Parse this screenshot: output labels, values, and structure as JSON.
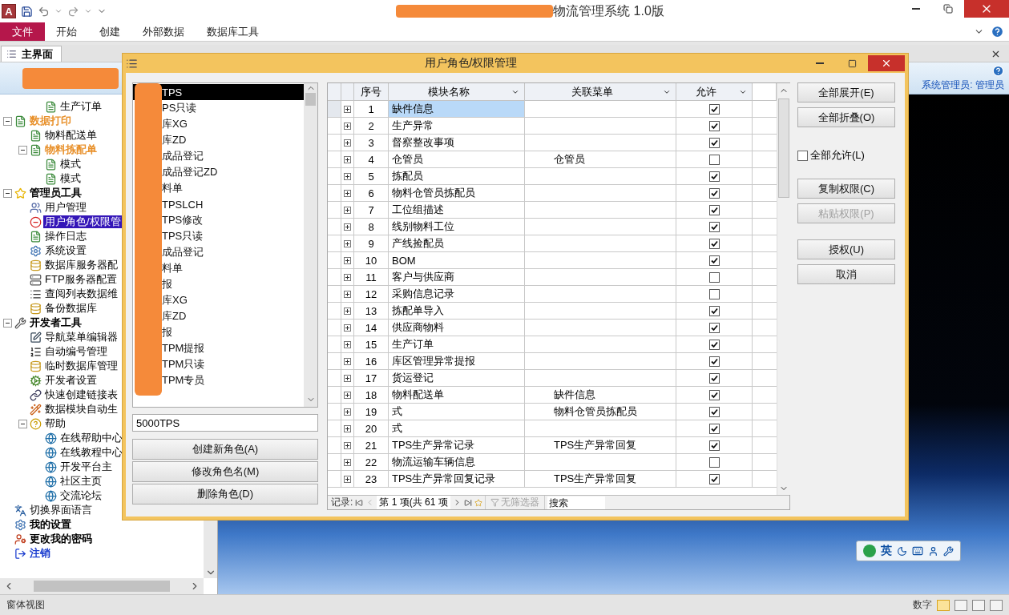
{
  "app": {
    "logo": "A",
    "title": "物流管理系统 1.0版"
  },
  "ribbon_tabs": [
    {
      "label": "文件",
      "selected": true
    },
    {
      "label": "开始",
      "selected": false
    },
    {
      "label": "创建",
      "selected": false
    },
    {
      "label": "外部数据",
      "selected": false
    },
    {
      "label": "数据库工具",
      "selected": false
    }
  ],
  "document_tab": {
    "label": "主界面"
  },
  "banner": {
    "user": "系统管理员: 管理员"
  },
  "nav_tree": [
    {
      "children": [
        {
          "children": [
            {
              "label": "生产订单",
              "kind": "page",
              "selected": false
            }
          ]
        }
      ]
    },
    {
      "label": "数据打印",
      "kind": "folder",
      "selected": false,
      "expanded": true,
      "children": [
        {
          "label": "物料配送单",
          "kind": "page",
          "selected": false
        },
        {
          "label": "物料拣配单",
          "kind": "folder",
          "selected": false,
          "expanded": true,
          "children": [
            {
              "label": "模式",
              "kind": "page",
              "selected": false
            },
            {
              "label": "模式",
              "kind": "page",
              "selected": false
            }
          ]
        }
      ]
    },
    {
      "label": "管理员工具",
      "kind": "category",
      "selected": false,
      "expanded": true,
      "children": [
        {
          "label": "用户管理",
          "kind": "page",
          "selected": false
        },
        {
          "label": "用户角色/权限管",
          "kind": "page",
          "selected": true
        },
        {
          "label": "操作日志",
          "kind": "page",
          "selected": false
        },
        {
          "label": "系统设置",
          "kind": "page",
          "selected": false
        },
        {
          "label": "数据库服务器配",
          "kind": "page",
          "selected": false
        },
        {
          "label": "FTP服务器配置",
          "kind": "page",
          "selected": false
        },
        {
          "label": "查阅列表数据维",
          "kind": "page",
          "selected": false
        },
        {
          "label": "备份数据库",
          "kind": "page",
          "selected": false
        }
      ]
    },
    {
      "label": "开发者工具",
      "kind": "category",
      "selected": false,
      "expanded": true,
      "children": [
        {
          "label": "导航菜单编辑器",
          "kind": "page",
          "selected": false
        },
        {
          "label": "自动编号管理",
          "kind": "page",
          "selected": false
        },
        {
          "label": "临时数据库管理",
          "kind": "page",
          "selected": false
        },
        {
          "label": "开发者设置",
          "kind": "page",
          "selected": false
        },
        {
          "label": "快速创建链接表",
          "kind": "page",
          "selected": false
        },
        {
          "label": "数据模块自动生",
          "kind": "page",
          "selected": false
        },
        {
          "label": "帮助",
          "kind": "page",
          "selected": false,
          "expanded": true,
          "children": [
            {
              "label": "在线帮助中心",
              "kind": "page",
              "selected": false
            },
            {
              "label": "在线教程中心",
              "kind": "page",
              "selected": false
            },
            {
              "label": "开发平台主",
              "kind": "page",
              "selected": false
            },
            {
              "label": "社区主页",
              "kind": "page",
              "selected": false
            },
            {
              "label": "交流论坛",
              "kind": "page",
              "selected": false
            }
          ]
        }
      ]
    },
    {
      "label": "切换界面语言",
      "kind": "page",
      "selected": false
    },
    {
      "label": "我的设置",
      "kind": "action",
      "selected": false
    },
    {
      "label": "更改我的密码",
      "kind": "action",
      "selected": false
    },
    {
      "label": "注销",
      "kind": "signout",
      "selected": false
    }
  ],
  "dialog": {
    "title": "用户角色/权限管理",
    "roles": [
      {
        "label": "TPS",
        "selected": true
      },
      {
        "label": "PS只读",
        "selected": false
      },
      {
        "label": "库XG",
        "selected": false
      },
      {
        "label": "库ZD",
        "selected": false
      },
      {
        "label": "成品登记",
        "selected": false
      },
      {
        "label": "成品登记ZD",
        "selected": false
      },
      {
        "label": "料单",
        "selected": false
      },
      {
        "label": "TPSLCH",
        "selected": false
      },
      {
        "label": "TPS修改",
        "selected": false
      },
      {
        "label": "TPS只读",
        "selected": false
      },
      {
        "label": "成品登记",
        "selected": false
      },
      {
        "label": "料单",
        "selected": false
      },
      {
        "label": "报",
        "selected": false
      },
      {
        "label": "库XG",
        "selected": false
      },
      {
        "label": "库ZD",
        "selected": false
      },
      {
        "label": "报",
        "selected": false
      },
      {
        "label": "TPM提报",
        "selected": false
      },
      {
        "label": "TPM只读",
        "selected": false
      },
      {
        "label": "TPM专员",
        "selected": false
      }
    ],
    "role_name": "5000TPS",
    "role_buttons": [
      "创建新角色(A)",
      "修改角色名(M)",
      "删除角色(D)"
    ],
    "table": {
      "columns": [
        "序号",
        "模块名称",
        "关联菜单",
        "允许"
      ],
      "rows": [
        {
          "seq": "1",
          "module": "缺件信息",
          "allowed": true,
          "selected": true
        },
        {
          "seq": "2",
          "module": "生产异常",
          "allowed": true,
          "selected": false
        },
        {
          "seq": "3",
          "module": "督察整改事项",
          "allowed": true,
          "selected": false
        },
        {
          "seq": "4",
          "module": "仓管员",
          "menu": "仓管员",
          "allowed": false,
          "selected": false
        },
        {
          "seq": "5",
          "module": "拣配员",
          "allowed": true,
          "selected": false
        },
        {
          "seq": "6",
          "module": "物料仓管员拣配员",
          "allowed": true,
          "selected": false
        },
        {
          "seq": "7",
          "module": "工位组描述",
          "allowed": true,
          "selected": false
        },
        {
          "seq": "8",
          "module": "线别物料工位",
          "allowed": true,
          "selected": false
        },
        {
          "seq": "9",
          "module": "产线捡配员",
          "allowed": true,
          "selected": false
        },
        {
          "seq": "10",
          "module": "BOM",
          "allowed": true,
          "selected": false
        },
        {
          "seq": "11",
          "module": "客户与供应商",
          "allowed": false,
          "selected": false
        },
        {
          "seq": "12",
          "module": "采购信息记录",
          "allowed": false,
          "selected": false
        },
        {
          "seq": "13",
          "module": "拣配单导入",
          "allowed": true,
          "selected": false
        },
        {
          "seq": "14",
          "module": "供应商物料",
          "allowed": true,
          "selected": false
        },
        {
          "seq": "15",
          "module": "生产订单",
          "allowed": true,
          "selected": false
        },
        {
          "seq": "16",
          "module": "库区管理异常提报",
          "allowed": true,
          "selected": false
        },
        {
          "seq": "17",
          "module": "货运登记",
          "allowed": true,
          "selected": false
        },
        {
          "seq": "18",
          "module": "物料配送单",
          "menu": "缺件信息",
          "allowed": true,
          "selected": false
        },
        {
          "seq": "19",
          "module": "式",
          "menu": "物料仓管员拣配员",
          "allowed": true,
          "selected": false
        },
        {
          "seq": "20",
          "module": "式",
          "allowed": true,
          "selected": false
        },
        {
          "seq": "21",
          "module": "TPS生产异常记录",
          "menu": "TPS生产异常回复",
          "allowed": true,
          "selected": false
        },
        {
          "seq": "22",
          "module": "物流运输车辆信息",
          "allowed": false,
          "selected": false
        },
        {
          "seq": "23",
          "module": "TPS生产异常回复记录",
          "menu": "TPS生产异常回复",
          "allowed": true,
          "selected": false
        }
      ]
    },
    "record_nav": {
      "label": "记录:",
      "position": "第 1 项(共 61 项",
      "filter": "无筛选器",
      "search_placeholder": "搜索"
    },
    "side_groups": [
      [
        {
          "kind": "button",
          "label": "全部展开(E)",
          "disabled": false
        },
        {
          "kind": "button",
          "label": "全部折叠(O)",
          "disabled": false
        }
      ],
      [
        {
          "kind": "checkbox",
          "label": "全部允许(L)",
          "checked": false
        }
      ],
      [
        {
          "kind": "button",
          "label": "复制权限(C)",
          "disabled": false
        },
        {
          "kind": "button",
          "label": "粘贴权限(P)",
          "disabled": true
        }
      ],
      [
        {
          "kind": "button",
          "label": "授权(U)",
          "disabled": false
        },
        {
          "kind": "button",
          "label": "取消",
          "disabled": false
        }
      ]
    ]
  },
  "ime_bar": {
    "label": "英"
  },
  "status_bar": {
    "left": "窗体视图",
    "right": "数字"
  }
}
